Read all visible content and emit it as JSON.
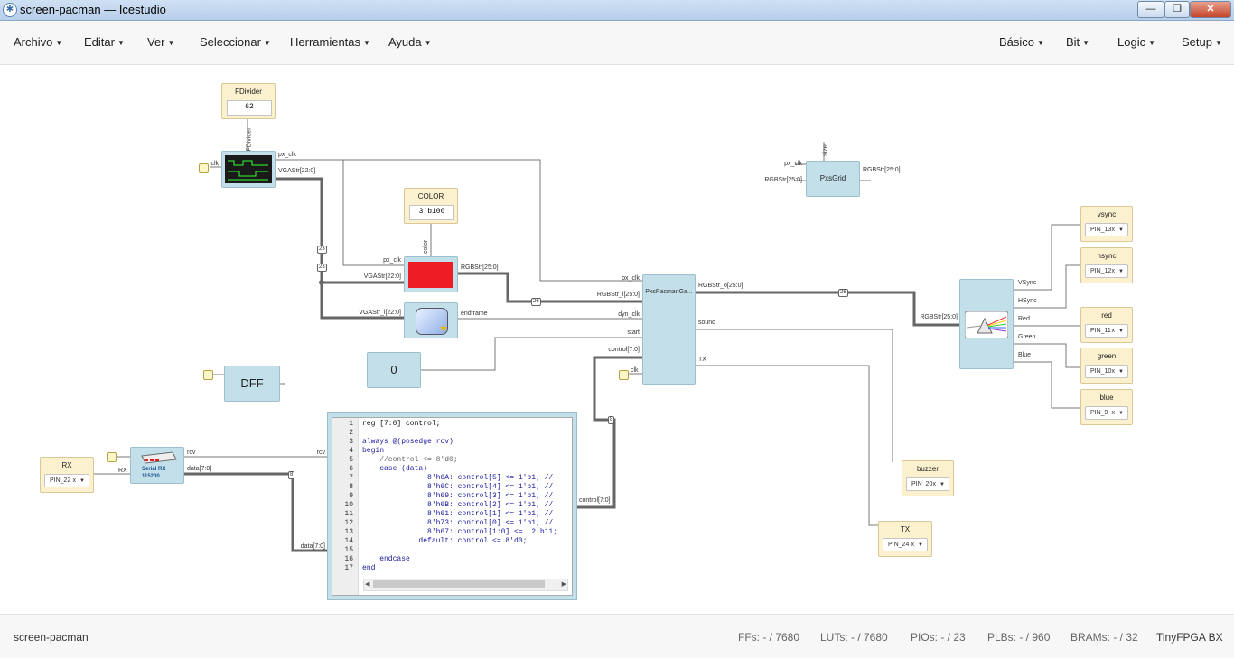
{
  "window": {
    "title": "screen-pacman — Icestudio",
    "buttons": [
      "—",
      "❐",
      "✕"
    ]
  },
  "menu": {
    "left": [
      "Archivo",
      "Editar",
      "Ver",
      "Seleccionar",
      "Herramientas",
      "Ayuda"
    ],
    "right": [
      "Básico",
      "Bit",
      "Logic",
      "Setup"
    ]
  },
  "blocks": {
    "fdivider": {
      "title": "FDivider",
      "value": "62",
      "rotated": "FDivider"
    },
    "divider": {
      "in": "clk",
      "out1": "px_clk",
      "out2": "VGAStr[22:0]"
    },
    "color": {
      "title": "COLOR",
      "value": "3'b100",
      "rotated": "color"
    },
    "redblk": {
      "in1": "px_clk",
      "in2": "VGAStr[22:0]",
      "out": "RGBStr[25:0]"
    },
    "sprite": {
      "in": "VGAStr_i[22:0]",
      "out": "endframe"
    },
    "const0": {
      "value": "0"
    },
    "dff": {
      "label": "DFF"
    },
    "pacman": {
      "title": "PxsPacmanGa...",
      "in1": "px_clk",
      "in2": "RGBStr_i[25:0]",
      "in3": "dyn_clk",
      "in4": "start",
      "in5": "control[7:0]",
      "in6": "clk",
      "out1": "RGBStr_o[25:0]",
      "out2": "sound",
      "out3": "TX"
    },
    "grid": {
      "title": "PxsGrid",
      "in1": "px_clk",
      "in2": "RGBStr[25:0]",
      "top": "size",
      "out": "RGBStr[25:0]"
    },
    "vga": {
      "in": "RGBStr[25:0]",
      "out1": "VSync",
      "out2": "HSync",
      "out3": "Red",
      "out4": "Green",
      "out5": "Blue"
    },
    "serial": {
      "label1": "Serial RX",
      "label2": "115200",
      "in": "RX",
      "out1": "rcv",
      "out2": "data[7:0]"
    },
    "ctrl": {
      "in1": "rcv",
      "in2": "data[7:0]",
      "out": "control[7:0]"
    },
    "bus": {
      "b26a": "26",
      "b26b": "26",
      "b26c": "26",
      "b23a": "23",
      "b23b": "23",
      "b8a": "8",
      "b8b": "8"
    }
  },
  "pins": {
    "vsync": {
      "name": "vsync",
      "pin": "PIN_13"
    },
    "hsync": {
      "name": "hsync",
      "pin": "PIN_12"
    },
    "red": {
      "name": "red",
      "pin": "PIN_11"
    },
    "green": {
      "name": "green",
      "pin": "PIN_10"
    },
    "blue": {
      "name": "blue",
      "pin": "PIN_9"
    },
    "buzzer": {
      "name": "buzzer",
      "pin": "PIN_20"
    },
    "tx": {
      "name": "TX",
      "pin": "PIN_24"
    },
    "rx": {
      "name": "RX",
      "pin": "PIN_22"
    },
    "x": "x"
  },
  "code": {
    "lines": [
      "reg [7:0] control;",
      "",
      "always @(posedge rcv)",
      "begin",
      "    //control <= 8'd0;",
      "    case (data)",
      "               8'h6A: control[5] <= 1'b1; //",
      "               8'h6C: control[4] <= 1'b1; //",
      "               8'h69: control[3] <= 1'b1; //",
      "               8'h6B: control[2] <= 1'b1; //",
      "               8'h61: control[1] <= 1'b1; //",
      "               8'h73: control[0] <= 1'b1; //",
      "               8'h67: control[1:0] <=  2'b11;",
      "             default: control <= 8'd0;",
      "",
      "    endcase",
      "end"
    ],
    "numbers": [
      "1",
      "2",
      "3",
      "4",
      "5",
      "6",
      "7",
      "8",
      "9",
      "10",
      "11",
      "12",
      "13",
      "14",
      "15",
      "16",
      "17"
    ]
  },
  "status": {
    "project": "screen-pacman",
    "ffs": "FFs:  - / 7680",
    "luts": "LUTs:  - / 7680",
    "pios": "PIOs:  - / 23",
    "plbs": "PLBs:  - / 960",
    "brams": "BRAMs:  - / 32",
    "board": "TinyFPGA BX"
  },
  "colors": {
    "block": "#c3e0ea",
    "constant": "#fbf1cf",
    "red_display": "#ee1c24",
    "accent": "#1a4f8c"
  }
}
